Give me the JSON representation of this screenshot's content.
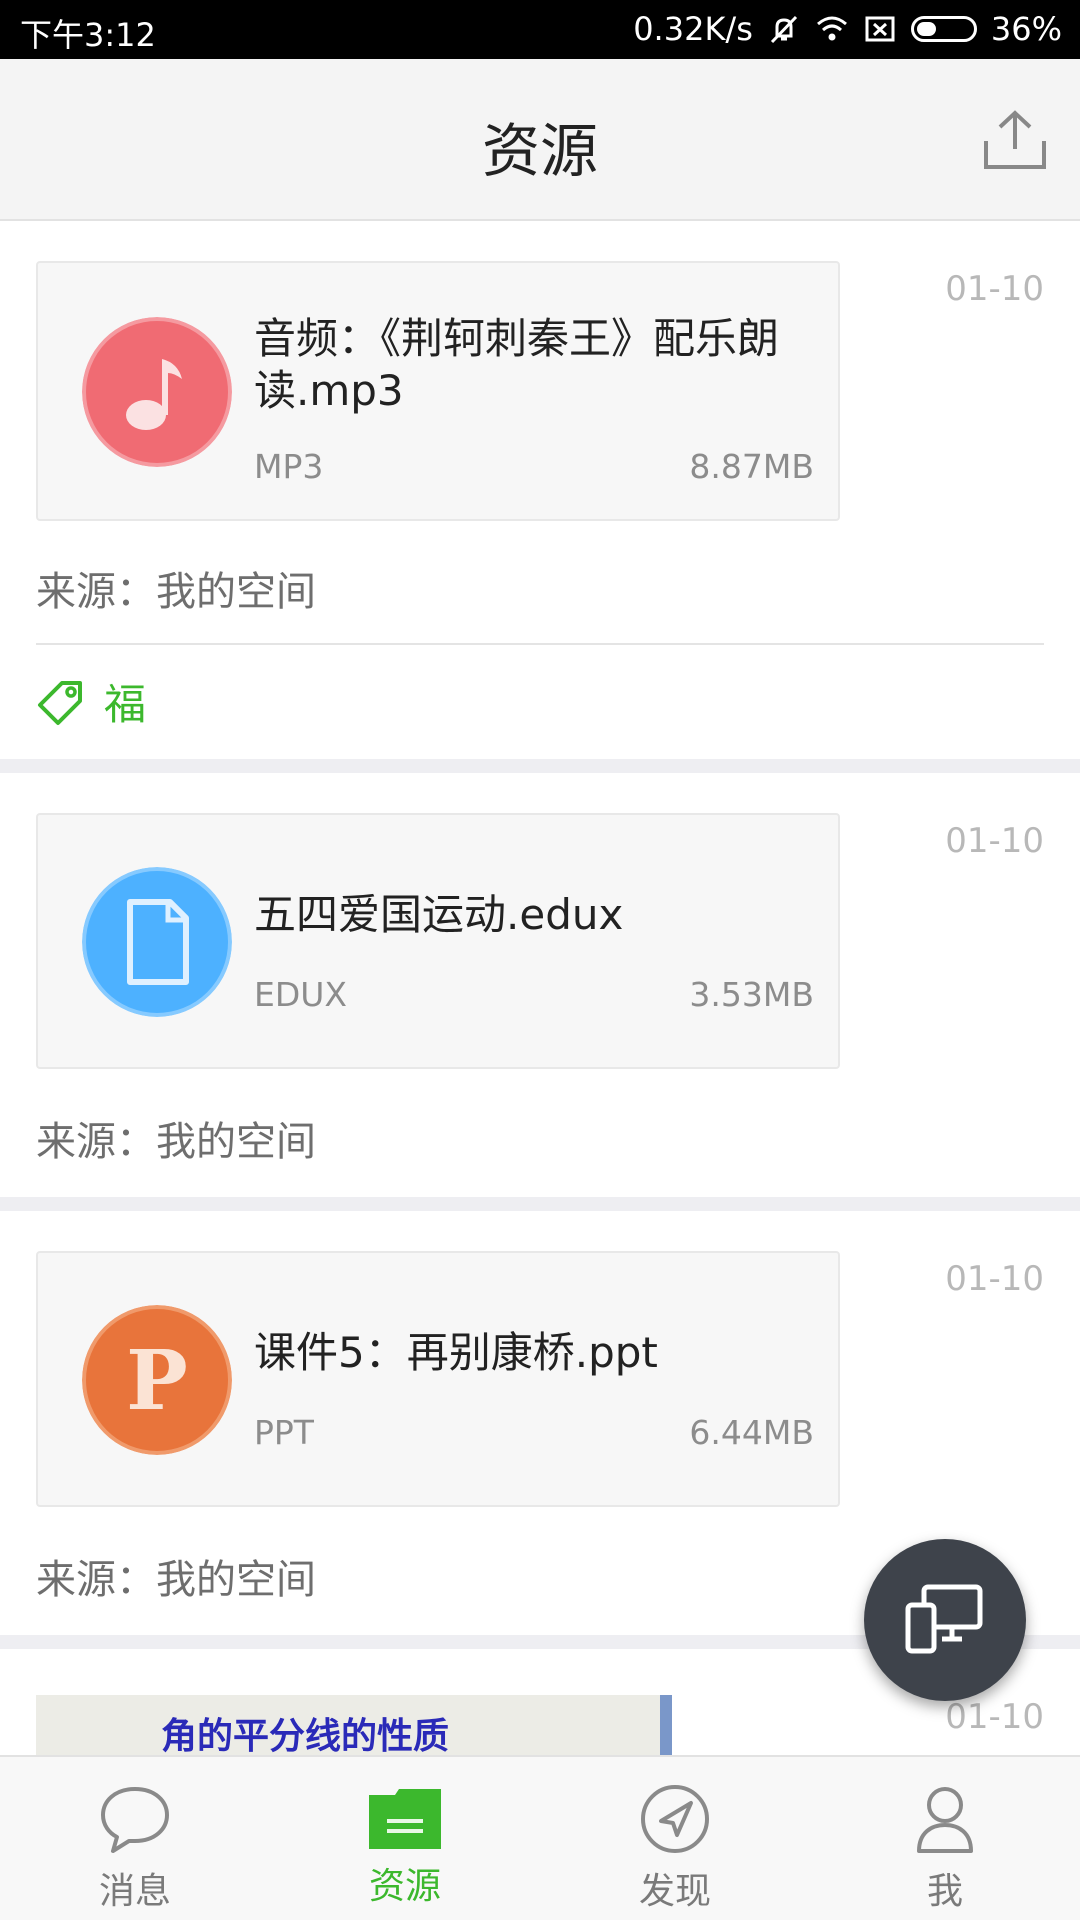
{
  "status_bar": {
    "time": "下午3:12",
    "speed": "0.32K/s",
    "battery": "36%",
    "battery_level": 0.36
  },
  "header": {
    "title": "资源",
    "upload_icon": "upload-icon"
  },
  "items": [
    {
      "date": "01-10",
      "icon": "music-note-icon",
      "icon_color": "#f06b73",
      "name": "音频：《荆轲刺秦王》配乐朗读.mp3",
      "type": "MP3",
      "size": "8.87MB",
      "source": "来源：我的空间",
      "tag": "福"
    },
    {
      "date": "01-10",
      "icon": "document-icon",
      "icon_color": "#4db1ff",
      "name": "五四爱国运动.edux",
      "type": "EDUX",
      "size": "3.53MB",
      "source": "来源：我的空间"
    },
    {
      "date": "01-10",
      "icon": "ppt-icon",
      "icon_color": "#e8743b",
      "name": "课件5：再别康桥.ppt",
      "type": "PPT",
      "size": "6.44MB",
      "source": "来源：我的空间"
    },
    {
      "date": "01-10",
      "thumbnail_text": "角的平分线的性质"
    }
  ],
  "fab": {
    "icon": "screen-cast-icon"
  },
  "bottom_nav": [
    {
      "label": "消息",
      "icon": "chat-bubble-icon",
      "active": false
    },
    {
      "label": "资源",
      "icon": "folder-icon",
      "active": true
    },
    {
      "label": "发现",
      "icon": "compass-icon",
      "active": false
    },
    {
      "label": "我",
      "icon": "person-icon",
      "active": false
    }
  ],
  "colors": {
    "accent": "#3cb82d",
    "header_bg": "#f4f4f4",
    "separator": "#eeeef2",
    "fab_bg": "#3e434b"
  }
}
